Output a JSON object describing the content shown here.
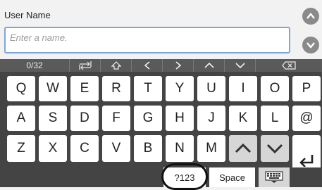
{
  "field": {
    "label": "User Name",
    "placeholder": "Enter a name."
  },
  "toolbar": {
    "counter": "0/32",
    "icons": [
      "tab-icon",
      "shift-icon",
      "cursor-left-icon",
      "cursor-right-icon",
      "caret-up-icon",
      "caret-down-icon",
      "backspace-icon"
    ]
  },
  "keyboard": {
    "row1": [
      "Q",
      "W",
      "E",
      "R",
      "T",
      "Y",
      "U",
      "I",
      "O",
      "P"
    ],
    "row2": [
      "A",
      "S",
      "D",
      "F",
      "G",
      "H",
      "J",
      "K",
      "L",
      "@"
    ],
    "row3": [
      "Z",
      "X",
      "C",
      "V",
      "B",
      "N",
      "M"
    ],
    "mode_label": "?123",
    "space_label": "Space"
  },
  "colors": {
    "accent_border": "#7da7d9",
    "keyboard_bg": "#444444",
    "toolbar_bg": "#5a5a5a",
    "scroll_button": "#8a8a8a"
  }
}
